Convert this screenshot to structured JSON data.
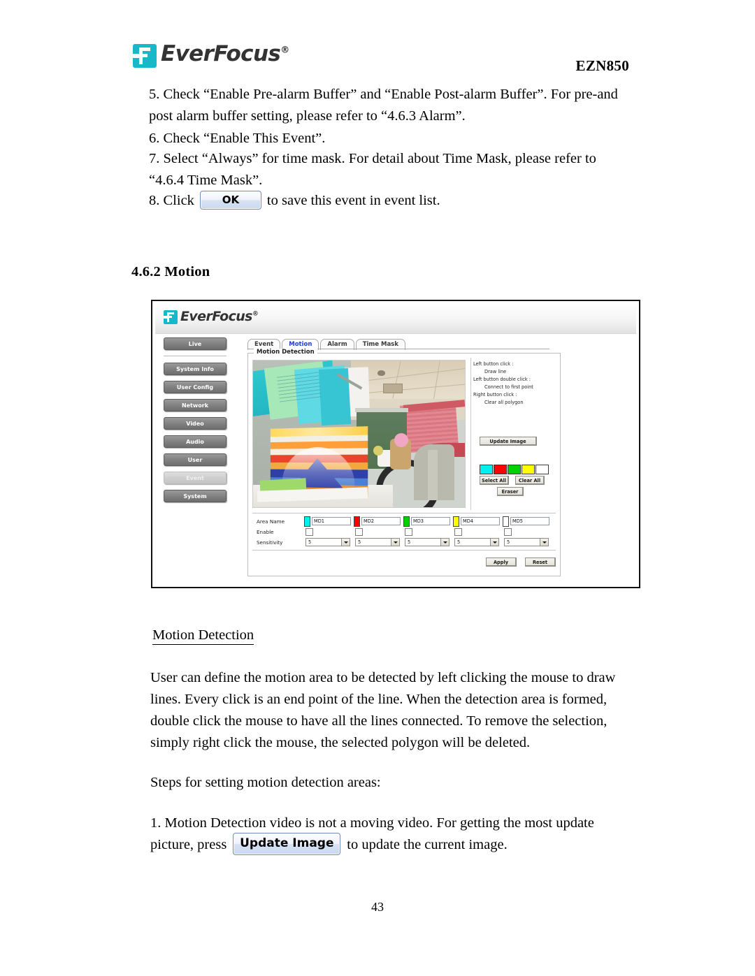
{
  "header": {
    "brand": "EverFocus",
    "brand_reg": "®",
    "model": "EZN850"
  },
  "steps": {
    "step5": "5. Check “Enable Pre-alarm Buffer” and “Enable Post-alarm Buffer”. For pre-and post alarm buffer setting, please refer to “4.6.3 Alarm”.",
    "step6": "6. Check “Enable This Event”.",
    "step7": "7. Select “Always” for time mask. For detail about Time Mask, please refer to “4.6.4 Time Mask”.",
    "step8_pre": "8. Click",
    "step8_btn": "OK",
    "step8_post": "to save this event in event list."
  },
  "section": {
    "heading": "4.6.2 Motion"
  },
  "figure": {
    "app_brand": "EverFocus",
    "app_brand_reg": "®",
    "sidebar": {
      "primary": [
        {
          "label": "Live",
          "active": false
        }
      ],
      "items": [
        {
          "label": "System Info",
          "active": false
        },
        {
          "label": "User Config",
          "active": false
        },
        {
          "label": "Network",
          "active": false
        },
        {
          "label": "Video",
          "active": false
        },
        {
          "label": "Audio",
          "active": false
        },
        {
          "label": "User",
          "active": false
        },
        {
          "label": "Event",
          "active": true
        },
        {
          "label": "System",
          "active": false
        }
      ]
    },
    "tabs": [
      {
        "label": "Event",
        "selected": false
      },
      {
        "label": "Motion",
        "selected": true
      },
      {
        "label": "Alarm",
        "selected": false
      },
      {
        "label": "Time Mask",
        "selected": false
      }
    ],
    "fieldset_legend": "Motion Detection",
    "hints": [
      {
        "title": "Left button click :",
        "detail": "Draw line"
      },
      {
        "title": "Left button double click :",
        "detail": "Connect to first point"
      },
      {
        "title": "Right button click :",
        "detail": "Clear all polygon"
      }
    ],
    "buttons": {
      "update_image": "Update Image",
      "select_all": "Select All",
      "clear_all": "Clear All",
      "eraser": "Eraser",
      "apply": "Apply",
      "reset": "Reset"
    },
    "swatches": [
      "#00f0f0",
      "#ff0000",
      "#00d200",
      "#ffff00",
      "#ffffff"
    ],
    "table": {
      "row_labels": [
        "Area Name",
        "Enable",
        "Sensitivity"
      ],
      "areas": [
        {
          "name": "MD1",
          "color": "#00f0f0",
          "enabled": false,
          "sensitivity": "5"
        },
        {
          "name": "MD2",
          "color": "#ff0000",
          "enabled": false,
          "sensitivity": "5"
        },
        {
          "name": "MD3",
          "color": "#00d200",
          "enabled": false,
          "sensitivity": "5"
        },
        {
          "name": "MD4",
          "color": "#ffff00",
          "enabled": false,
          "sensitivity": "5"
        },
        {
          "name": "MD5",
          "color": "#ffffff",
          "enabled": false,
          "sensitivity": "5"
        }
      ]
    }
  },
  "body": {
    "caption": "Motion Detection",
    "paragraph": "User can define the motion area to be detected by left clicking the mouse to draw lines. Every click is an end point of the line. When the detection area is formed, double click the mouse to have all the lines connected. To remove the selection, simply right click the mouse, the selected polygon will be deleted.",
    "steps_intro": "Steps for setting motion detection areas:",
    "step1_pre": "1. Motion Detection video is not a moving video. For getting the most update picture, press",
    "step1_btn": "Update Image",
    "step1_post": "to update the current image."
  },
  "footer": {
    "page_number": "43"
  }
}
